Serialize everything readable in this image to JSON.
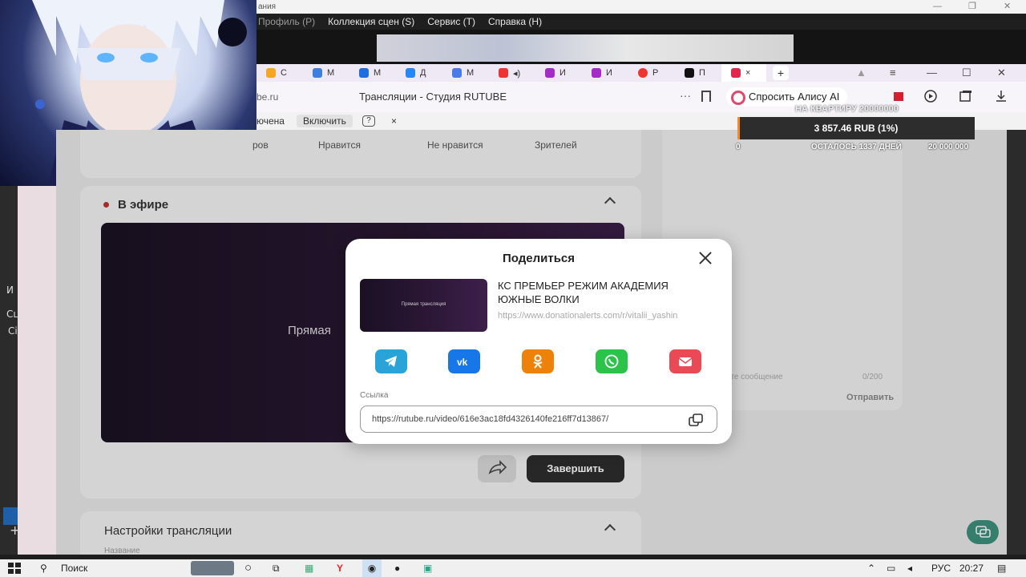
{
  "obs": {
    "title_fragment": "ания",
    "menu": [
      "Профиль (P)",
      "Коллекция сцен (S)",
      "Сервис (T)",
      "Справка (H)"
    ]
  },
  "browser": {
    "tabs": [
      {
        "label": "С",
        "color": "#f5a623"
      },
      {
        "label": "М",
        "color": "#3d7fe0"
      },
      {
        "label": "М",
        "color": "#1d6fe0"
      },
      {
        "label": "Д",
        "color": "#2787f5"
      },
      {
        "label": "М",
        "color": "#4a7ae8"
      },
      {
        "label": "",
        "color": "#e33"
      },
      {
        "label": "И",
        "color": "#a42cc6"
      },
      {
        "label": "И",
        "color": "#a42cc6"
      },
      {
        "label": "Р",
        "color": "#e33"
      },
      {
        "label": "П",
        "color": "#111"
      }
    ],
    "active_tab_close": "×",
    "new_tab": "+",
    "address_host": "be.ru",
    "page_title": "Трансляции - Студия RUTUBE",
    "more": "···",
    "alice_label": "Спросить Алису AI",
    "notif_fragment": "ючена",
    "notif_enable": "Включить",
    "notif_help": "?",
    "notif_close": "×"
  },
  "page": {
    "stats": [
      "ров",
      "Нравится",
      "Не нравится",
      "Зрителей"
    ],
    "live_title": "В эфире",
    "player_text": "Прямая",
    "finish_label": "Завершить",
    "settings_title": "Настройки трансляции",
    "settings_sub": "Название",
    "chat_placeholder": "...ните сообщение",
    "chat_count": "0/200",
    "chat_send": "Отправить"
  },
  "donation": {
    "goal_title": "НА КВАРТИРУ 20000000",
    "amount": "3 857.46 RUB (1%)",
    "progress_fraction": 0.01,
    "min": "0",
    "remaining": "ОСТАЛОСЬ 1337 ДНЕЙ",
    "max": "20 000 000"
  },
  "modal": {
    "title": "Поделиться",
    "thumb_text": "Прямая трансляция",
    "video_title": "КС ПРЕМЬЕР РЕЖИМ АКАДЕМИЯ ЮЖНЫЕ ВОЛКИ",
    "video_url": "https://www.donationalerts.com/r/vitalii_yashin",
    "share_colors": {
      "telegram": "#2aa3d9",
      "vk": "#1877e8",
      "ok": "#ee8208",
      "whatsapp": "#2cc34a",
      "email": "#ea4a55"
    },
    "link_label": "Ссылка",
    "link_value": "https://rutube.ru/video/616e3ac18fd4326140fe216ff7d13867/"
  },
  "taskbar": {
    "search_label": "Поиск",
    "lang": "РУС",
    "time": "20:27"
  },
  "obs_side": {
    "labels": [
      "И",
      "Сц",
      "Сі"
    ]
  }
}
